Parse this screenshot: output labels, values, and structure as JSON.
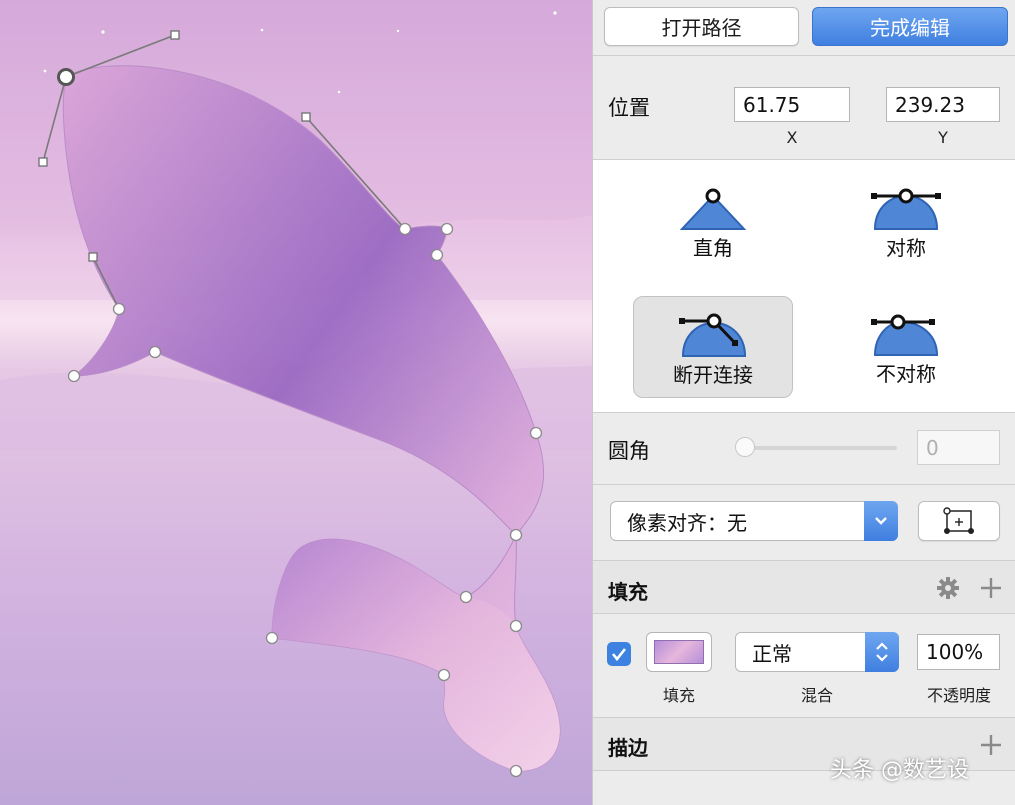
{
  "toolbar": {
    "open_path_label": "打开路径",
    "finish_edit_label": "完成编辑"
  },
  "position": {
    "label": "位置",
    "x_value": "61.75",
    "y_value": "239.23",
    "x_caption": "X",
    "y_caption": "Y"
  },
  "point_types": [
    {
      "label": "直角",
      "icon": "corner-point-icon",
      "selected": false
    },
    {
      "label": "对称",
      "icon": "mirrored-point-icon",
      "selected": false
    },
    {
      "label": "断开连接",
      "icon": "disconnected-point-icon",
      "selected": true
    },
    {
      "label": "不对称",
      "icon": "asymmetric-point-icon",
      "selected": false
    }
  ],
  "corner_radius": {
    "label": "圆角",
    "value": "0",
    "slider_fraction": 0
  },
  "pixel_align": {
    "selected": "像素对齐：无",
    "icon": "pixel-grid-icon"
  },
  "fill": {
    "title": "填充",
    "enabled": true,
    "blend_mode": "正常",
    "opacity": "100%",
    "captions": {
      "fill": "填充",
      "blend": "混合",
      "opacity": "不透明度"
    },
    "swatch_colors": [
      "#b58fd8",
      "#e7b6dc"
    ]
  },
  "stroke": {
    "title": "描边"
  },
  "watermark": "头条 @数艺设",
  "colors": {
    "accent": "#4a86e8",
    "whale": "#a97ccc",
    "background": "#d8b6e0"
  }
}
